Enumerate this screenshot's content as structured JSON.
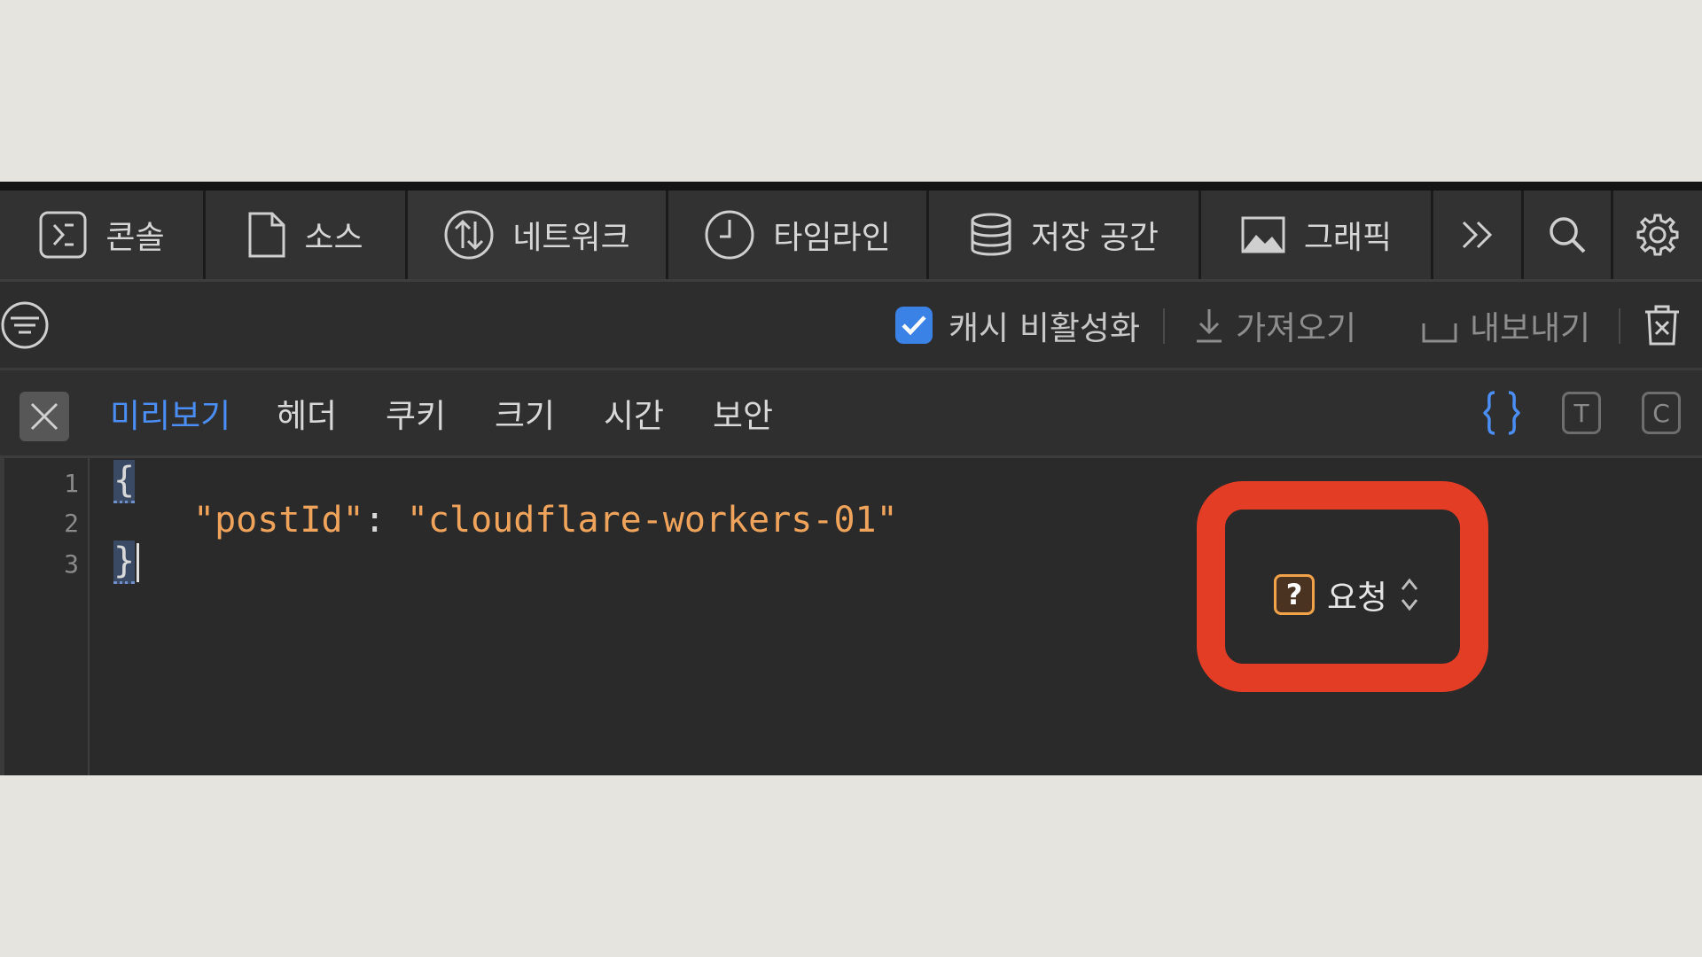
{
  "tabs": [
    {
      "label": "콘솔",
      "icon": "console-icon"
    },
    {
      "label": "소스",
      "icon": "document-icon"
    },
    {
      "label": "네트워크",
      "icon": "network-icon",
      "active": true
    },
    {
      "label": "타임라인",
      "icon": "clock-icon"
    },
    {
      "label": "저장 공간",
      "icon": "database-icon"
    },
    {
      "label": "그래픽",
      "icon": "image-icon"
    }
  ],
  "tab_tools": [
    "more-tabs-icon",
    "search-icon",
    "gear-icon"
  ],
  "filterbar": {
    "cache_label": "캐시 비활성화",
    "cache_checked": true,
    "import_label": "가져오기",
    "export_label": "내보내기"
  },
  "subtabs": [
    "미리보기",
    "헤더",
    "쿠키",
    "크기",
    "시간",
    "보안"
  ],
  "active_subtab": "미리보기",
  "request_selector": {
    "badge": "?",
    "label": "요청"
  },
  "format_buttons": [
    "T",
    "C"
  ],
  "code": {
    "line_numbers": [
      "1",
      "2",
      "3"
    ],
    "open_brace": "{",
    "key": "\"postId\"",
    "colon": ": ",
    "value": "\"cloudflare-workers-01\"",
    "close_brace": "}"
  },
  "colors": {
    "accent": "#4a8ef6",
    "string": "#f0a35a",
    "annotation": "#e43d25",
    "panel_bg": "#2a2a2a",
    "page_bg": "#e6e4df"
  }
}
